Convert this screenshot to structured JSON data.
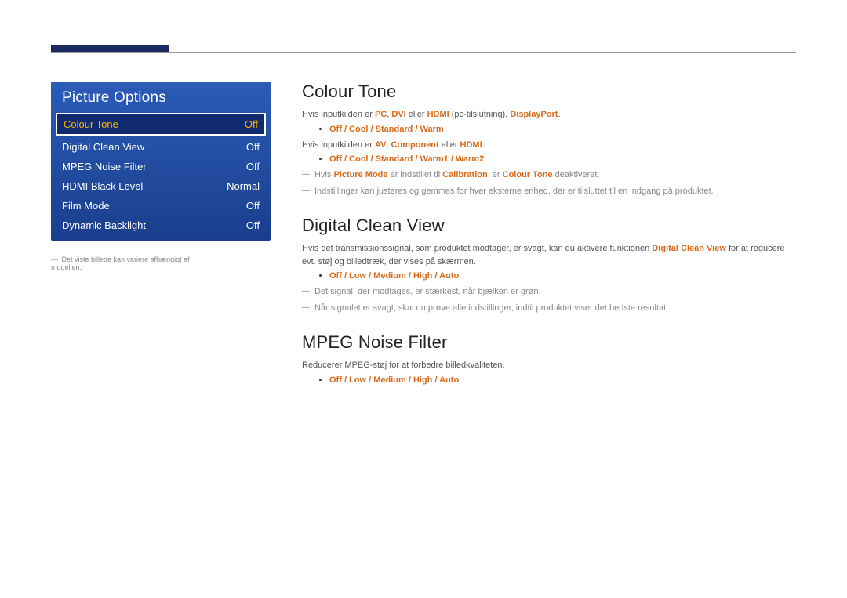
{
  "menu": {
    "title": "Picture Options",
    "items": [
      {
        "label": "Colour Tone",
        "value": "Off",
        "selected": true
      },
      {
        "label": "Digital Clean View",
        "value": "Off"
      },
      {
        "label": "MPEG Noise Filter",
        "value": "Off"
      },
      {
        "label": "HDMI Black Level",
        "value": "Normal"
      },
      {
        "label": "Film Mode",
        "value": "Off"
      },
      {
        "label": "Dynamic Backlight",
        "value": "Off"
      }
    ]
  },
  "left_caption": "Det viste billede kan variere afhængigt af modellen.",
  "colour_tone": {
    "heading": "Colour Tone",
    "line1_pre": "Hvis inputkilden er ",
    "pc": "PC",
    "c1": ", ",
    "dvi": "DVI",
    "mid1": " eller ",
    "hdmi1": "HDMI",
    "paren1": " (pc-tilslutning), ",
    "dp": "DisplayPort",
    "dot1": ".",
    "opts1": "Off / Cool / Standard / Warm",
    "line2_pre": "Hvis inputkilden er ",
    "av": "AV",
    "c2": ", ",
    "comp": "Component",
    "mid2": " eller ",
    "hdmi2": "HDMI",
    "dot2": ".",
    "opts2": "Off / Cool / Standard / Warm1 / Warm2",
    "note1_a": "Hvis ",
    "note1_pm": "Picture Mode",
    "note1_b": " er indstillet til ",
    "note1_cal": "Calibration",
    "note1_c": ", er ",
    "note1_ct": "Colour Tone",
    "note1_d": " deaktiveret.",
    "note2": "Indstillinger kan justeres og gemmes for hver eksterne enhed, der er tilsluttet til en indgang på produktet."
  },
  "dcv": {
    "heading": "Digital Clean View",
    "body_a": "Hvis det transmissionssignal, som produktet modtager, er svagt, kan du aktivere funktionen ",
    "body_hl": "Digital Clean View",
    "body_b": " for at reducere evt. støj og billedtræk, der vises på skærmen.",
    "opts": "Off / Low / Medium / High / Auto",
    "note1": "Det signal, der modtages, er stærkest, når bjælken er grøn.",
    "note2": "Når signalet er svagt, skal du prøve alle indstillinger, indtil produktet viser det bedste resultat."
  },
  "mpeg": {
    "heading": "MPEG Noise Filter",
    "body": "Reducerer MPEG-støj for at forbedre billedkvaliteten.",
    "opts": "Off / Low / Medium / High / Auto"
  }
}
